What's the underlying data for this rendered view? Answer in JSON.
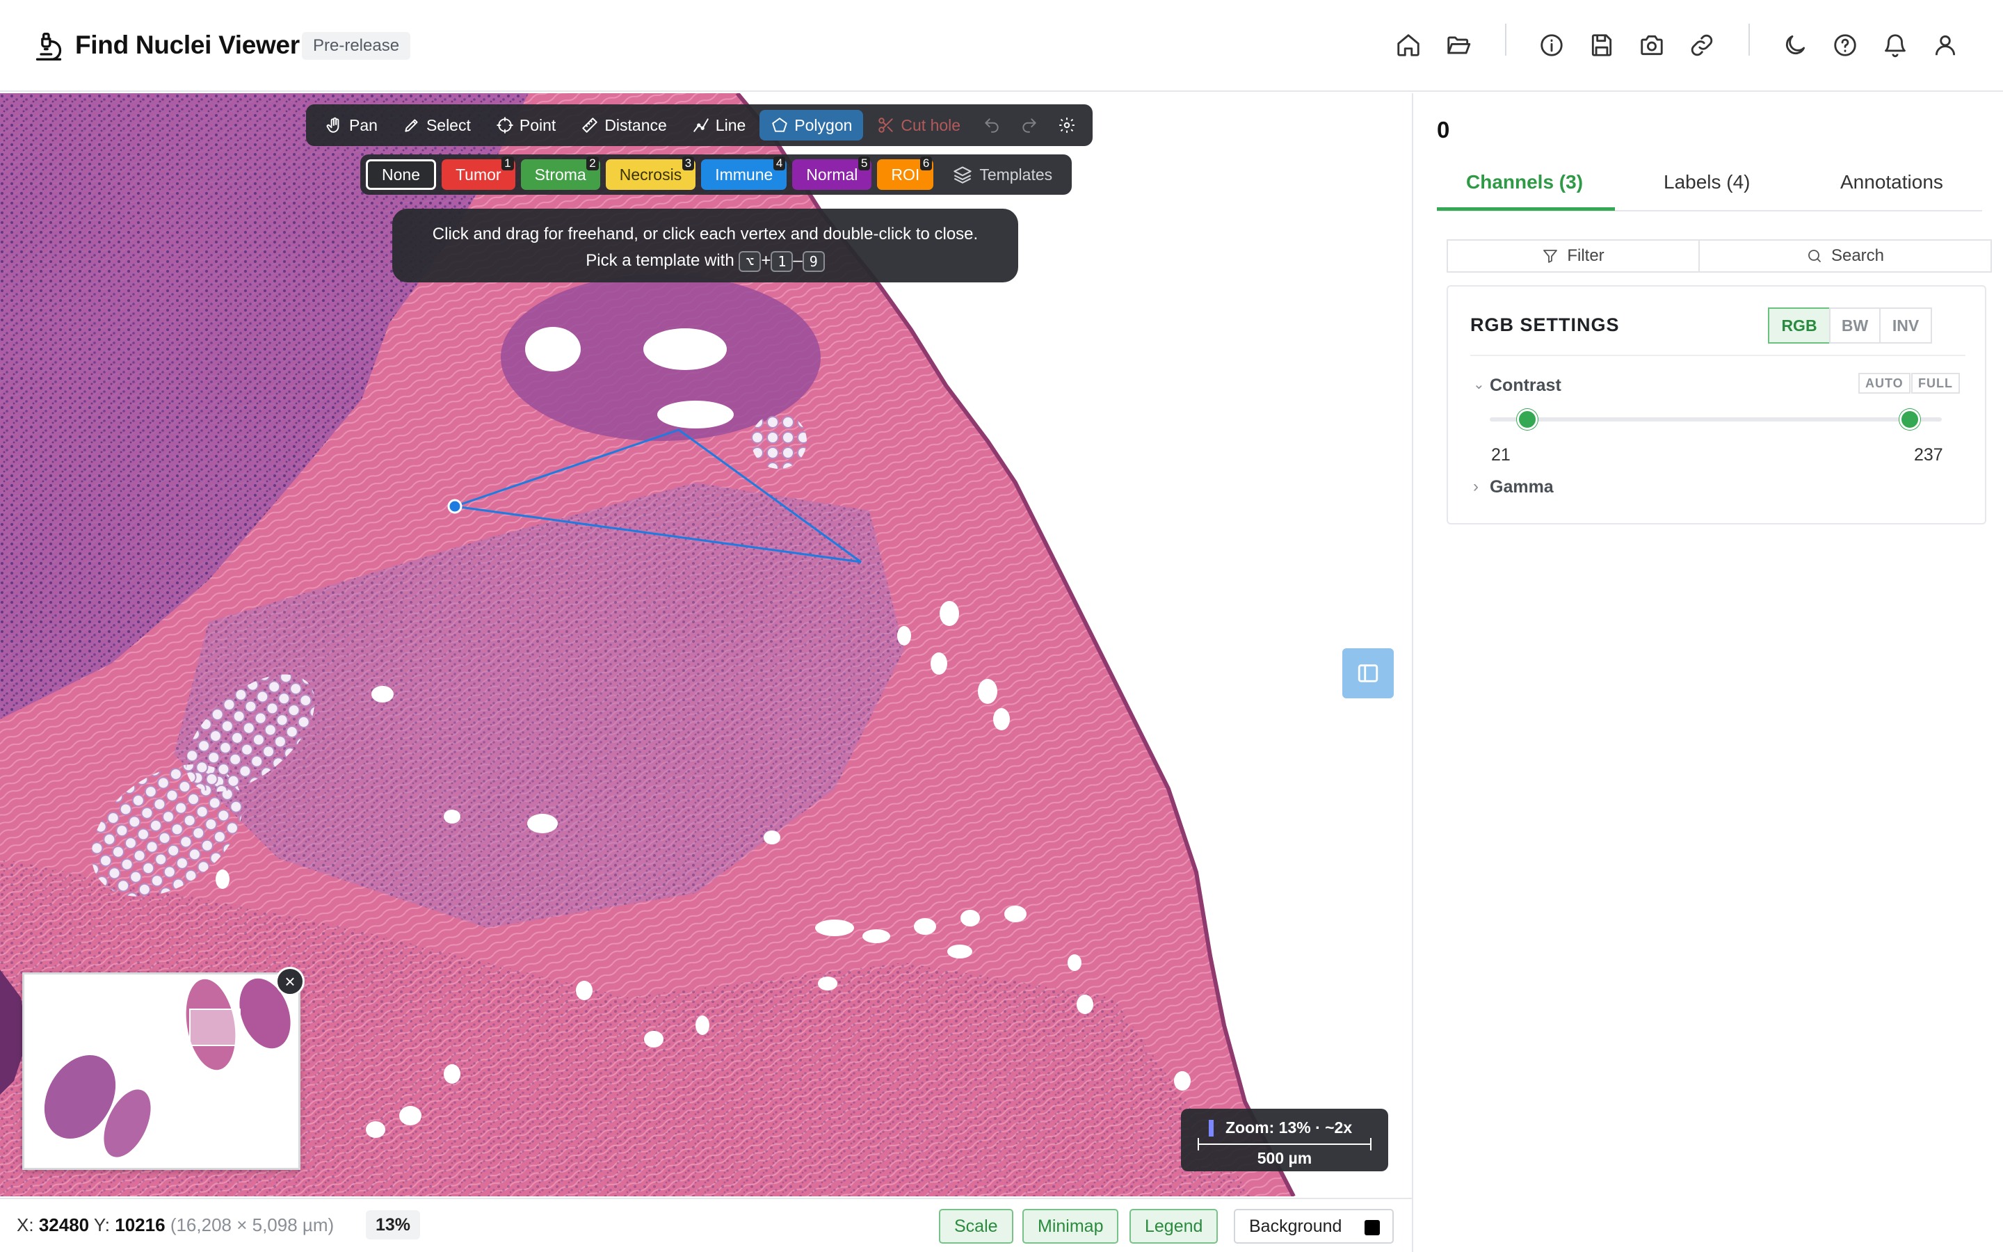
{
  "header": {
    "title": "Find Nuclei Viewer",
    "badge": "Pre-release",
    "icons": [
      "home-icon",
      "folder-open-icon",
      "info-icon",
      "save-icon",
      "camera-icon",
      "link-icon",
      "moon-icon",
      "help-icon",
      "bell-icon",
      "user-icon"
    ]
  },
  "toolbar": {
    "pan": "Pan",
    "select": "Select",
    "point": "Point",
    "distance": "Distance",
    "line": "Line",
    "polygon": "Polygon",
    "cut_hole": "Cut hole",
    "active_tool": "Polygon"
  },
  "classes": [
    {
      "label": "None",
      "key": "",
      "color": "#2a2c30"
    },
    {
      "label": "Tumor",
      "key": "1",
      "color": "#e53935"
    },
    {
      "label": "Stroma",
      "key": "2",
      "color": "#43a047"
    },
    {
      "label": "Necrosis",
      "key": "3",
      "color": "#f4d03f"
    },
    {
      "label": "Immune",
      "key": "4",
      "color": "#1e88e5"
    },
    {
      "label": "Normal",
      "key": "5",
      "color": "#8e24aa"
    },
    {
      "label": "ROI",
      "key": "6",
      "color": "#fb8c00"
    }
  ],
  "templates_label": "Templates",
  "hint": {
    "line1": "Click and drag for freehand, or click each vertex and double-click to close.",
    "line2_prefix": "Pick a template with",
    "key_mod": "⌥",
    "plus": "+",
    "key_from": "1",
    "dash": "–",
    "key_to": "9"
  },
  "zoom_overlay": {
    "zoom": "Zoom: 13% · ~2x",
    "scale": "500 µm"
  },
  "status": {
    "x_label": "X:",
    "x_value": "32480",
    "y_label": "Y:",
    "y_value": "10216",
    "size": "(16,208 × 5,098 µm)",
    "zoom_pct": "13%",
    "scale_btn": "Scale",
    "minimap_btn": "Minimap",
    "legend_btn": "Legend",
    "background_btn": "Background",
    "background_color": "#000000"
  },
  "panel": {
    "count": "0",
    "tabs": [
      "Channels (3)",
      "Labels (4)",
      "Annotations"
    ],
    "active_tab": "Channels (3)",
    "filter": "Filter",
    "search": "Search",
    "card_title": "RGB SETTINGS",
    "modes": [
      "RGB",
      "BW",
      "INV"
    ],
    "active_mode": "RGB",
    "contrast_label": "Contrast",
    "auto": "AUTO",
    "full": "FULL",
    "contrast_min": "21",
    "contrast_max": "237",
    "gamma_label": "Gamma",
    "accent": "#34a853"
  }
}
